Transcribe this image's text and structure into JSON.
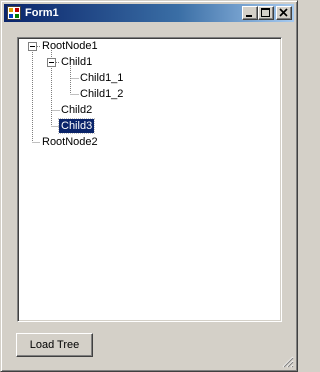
{
  "window": {
    "title": "Form1",
    "controls": {
      "minimize_icon": "minimize-icon",
      "maximize_icon": "maximize-icon",
      "close_icon": "close-icon"
    }
  },
  "tree": {
    "nodes": [
      {
        "label": "RootNode1",
        "level": 0,
        "expanded": true
      },
      {
        "label": "Child1",
        "level": 1,
        "expanded": true
      },
      {
        "label": "Child1_1",
        "level": 2
      },
      {
        "label": "Child1_2",
        "level": 2
      },
      {
        "label": "Child2",
        "level": 1
      },
      {
        "label": "Child3",
        "level": 1,
        "selected": true
      },
      {
        "label": "RootNode2",
        "level": 0
      }
    ]
  },
  "buttons": {
    "load_tree": "Load Tree"
  },
  "colors": {
    "face": "#d4d0c8",
    "title_start": "#0a246a",
    "title_end": "#a6caf0",
    "selection": "#0a246a"
  }
}
